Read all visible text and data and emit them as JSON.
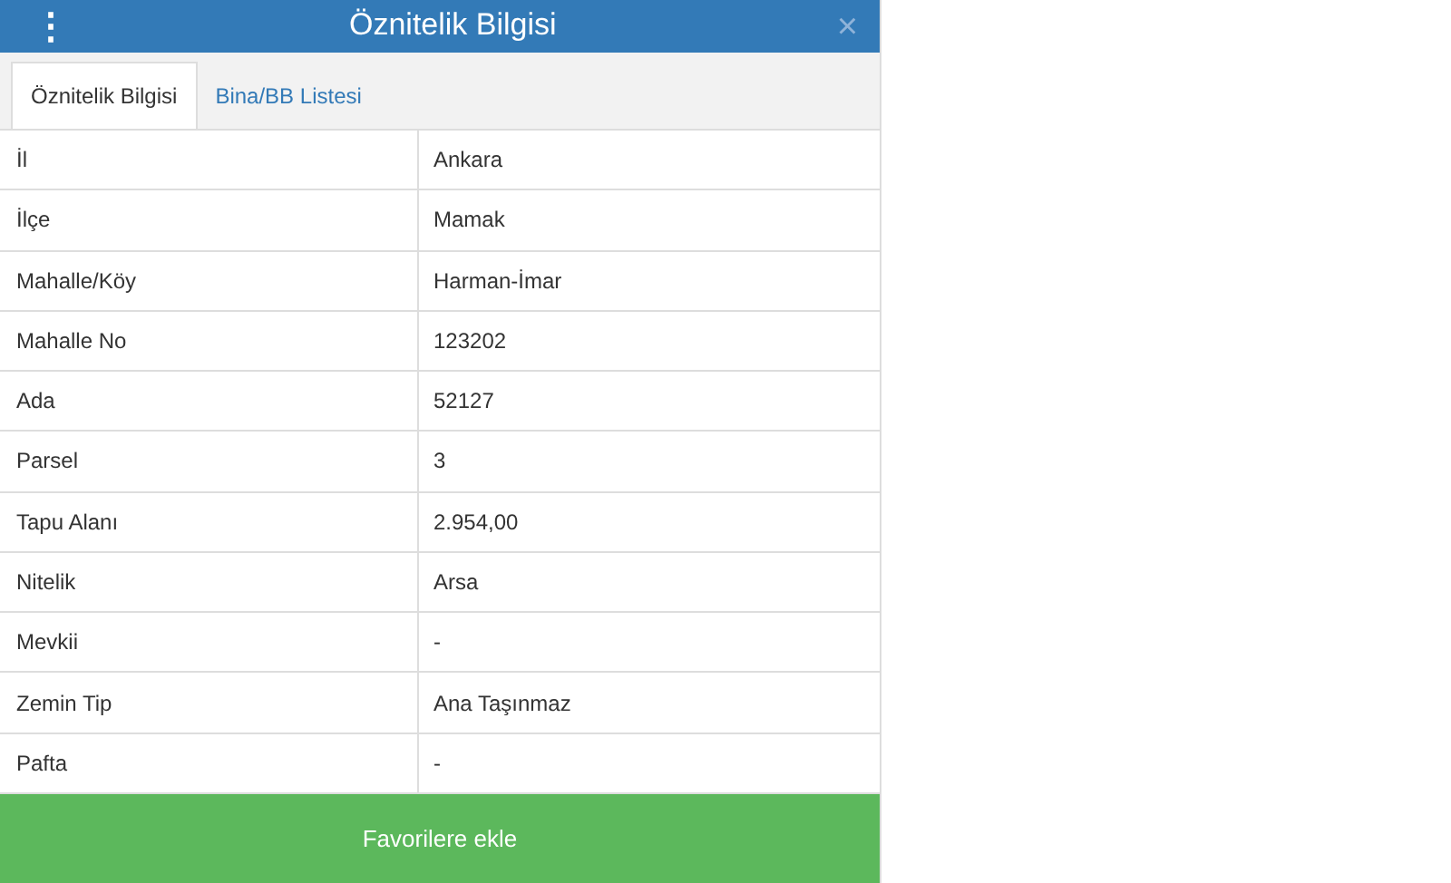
{
  "window": {
    "title": "Öznitelik Bilgisi",
    "menu_icon": "⋮",
    "close_icon": "×"
  },
  "tabs": [
    {
      "label": "Öznitelik Bilgisi",
      "selected": true
    },
    {
      "label": "Bina/BB Listesi",
      "selected": false
    }
  ],
  "table": {
    "rows": [
      {
        "label": "İl",
        "value": "Ankara"
      },
      {
        "label": "İlçe",
        "value": "Mamak"
      },
      {
        "label": "Mahalle/Köy",
        "value": "Harman-İmar"
      },
      {
        "label": "Mahalle No",
        "value": "123202"
      },
      {
        "label": "Ada",
        "value": "52127"
      },
      {
        "label": "Parsel",
        "value": "3"
      },
      {
        "label": "Tapu Alanı",
        "value": "2.954,00"
      },
      {
        "label": "Nitelik",
        "value": "Arsa"
      },
      {
        "label": "Mevkii",
        "value": "-"
      },
      {
        "label": "Zemin Tip",
        "value": "Ana Taşınmaz"
      },
      {
        "label": "Pafta",
        "value": "-"
      }
    ]
  },
  "button": {
    "label": "Favorilere ekle"
  }
}
